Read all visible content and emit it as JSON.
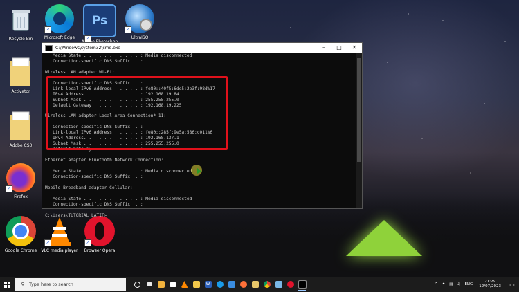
{
  "desktop": {
    "icons": [
      {
        "label": "Recycle Bin",
        "icon": "recycle-bin-icon"
      },
      {
        "label": "Microsoft Edge",
        "icon": "edge-icon"
      },
      {
        "label": "Adobe Photoshop CS3",
        "icon": "photoshop-icon"
      },
      {
        "label": "UltraISO",
        "icon": "ultraiso-icon"
      },
      {
        "label": "Activator",
        "icon": "folder-icon"
      },
      {
        "label": "Adobe CS3",
        "icon": "folder-icon"
      },
      {
        "label": "Firefox",
        "icon": "firefox-icon"
      },
      {
        "label": "Google Chrome",
        "icon": "chrome-icon"
      },
      {
        "label": "VLC media player",
        "icon": "vlc-icon"
      },
      {
        "label": "Browser Opera",
        "icon": "opera-icon"
      }
    ]
  },
  "cmd": {
    "title": "C:\\Windows\\system32\\cmd.exe",
    "lines": [
      "   Media State . . . . . . . . . . . : Media disconnected",
      "   Connection-specific DNS Suffix  . :",
      "",
      "Wireless LAN adapter Wi-Fi:",
      "",
      "   Connection-specific DNS Suffix  . :",
      "   Link-local IPv6 Address . . . . . : fe80::40f5:6de5:2b3f:98d%17",
      "   IPv4 Address. . . . . . . . . . . : 192.168.19.84",
      "   Subnet Mask . . . . . . . . . . . : 255.255.255.0",
      "   Default Gateway . . . . . . . . . : 192.168.19.225",
      "",
      "Wireless LAN adapter Local Area Connection* 11:",
      "",
      "   Connection-specific DNS Suffix  . :",
      "   Link-local IPv6 Address . . . . . : fe80::285f:9e5a:586:c011%6",
      "   IPv4 Address. . . . . . . . . . . : 192.168.137.1",
      "   Subnet Mask . . . . . . . . . . . : 255.255.255.0",
      "   Default Gateway . . . . . . . . . :",
      "",
      "Ethernet adapter Bluetooth Network Connection:",
      "",
      "   Media State . . . . . . . . . . . : Media disconnected",
      "   Connection-specific DNS Suffix  . :",
      "",
      "Mobile Broadband adapter Cellular:",
      "",
      "   Media State . . . . . . . . . . . : Media disconnected",
      "   Connection-specific DNS Suffix  . :",
      "",
      "C:\\Users\\TUTORIAL LATIF>"
    ]
  },
  "taskbar": {
    "search_placeholder": "Type here to search",
    "language": "ENG",
    "time": "21:29",
    "date": "12/07/2023"
  },
  "colors": {
    "highlight": "#e0111b",
    "cmd_bg": "#0c0c0c",
    "cmd_text": "#cccccc",
    "taskbar_bg": "#1c1c1c"
  }
}
